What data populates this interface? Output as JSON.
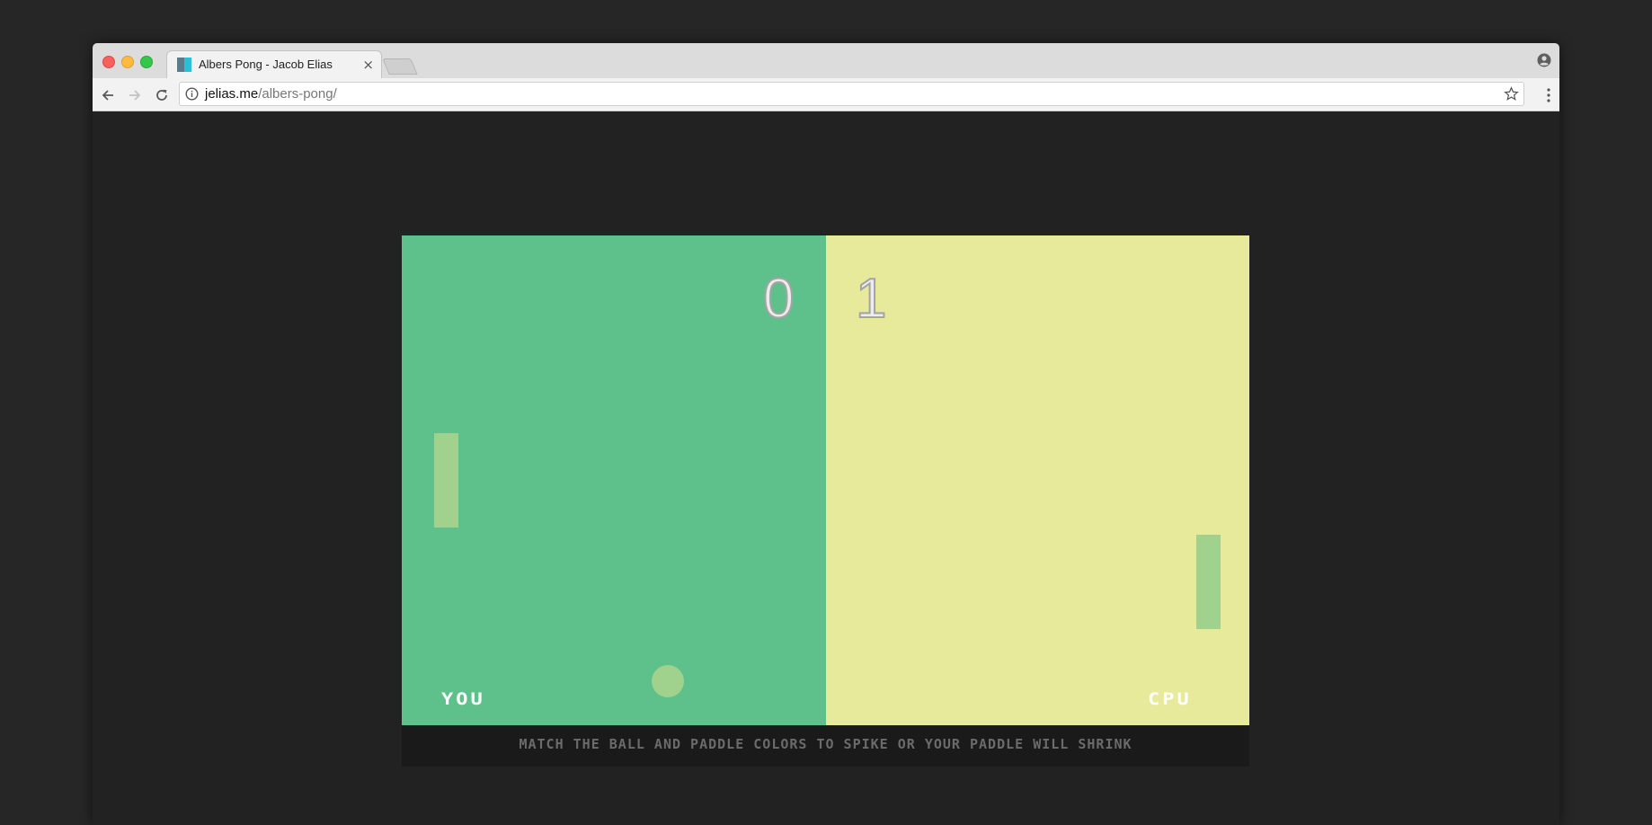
{
  "browser": {
    "tab_title": "Albers Pong - Jacob Elias",
    "tab_close": "×",
    "url_host": "jelias.me",
    "url_path": "/albers-pong/"
  },
  "game": {
    "player_score": "0",
    "cpu_score": "1",
    "player_label": "YOU",
    "cpu_label": "CPU",
    "hint": "MATCH THE BALL AND PADDLE COLORS TO SPIKE OR YOUR PADDLE WILL SHRINK",
    "colors": {
      "left_field": "#5ec08a",
      "right_field": "#e7ea9b",
      "paddles_and_ball": "#a0d18d",
      "hint_background": "#1a1a1a"
    }
  },
  "icons": {
    "back": "arrow-left-icon",
    "forward": "arrow-right-icon",
    "reload": "reload-icon",
    "info": "info-icon",
    "bookmark": "star-icon",
    "menu": "kebab-menu-icon",
    "profile": "profile-icon"
  }
}
